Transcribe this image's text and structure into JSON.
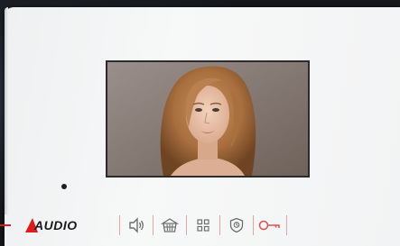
{
  "brand": {
    "logo_text": "AUDIO"
  },
  "screen": {
    "content": "portrait-photo"
  },
  "toolbar": {
    "buttons": [
      {
        "icon": "speaker-icon",
        "name": "speaker-button"
      },
      {
        "icon": "gate-basket-icon",
        "name": "gate-button"
      },
      {
        "icon": "grid-menu-icon",
        "name": "menu-button"
      },
      {
        "icon": "shield-icon",
        "name": "security-button"
      },
      {
        "icon": "key-icon",
        "name": "door-open-button"
      }
    ]
  },
  "colors": {
    "accent_red": "#e01a1a",
    "icon_gray": "#6e6e6e",
    "key_red": "#e05050",
    "separator": "#e0a6a6"
  }
}
